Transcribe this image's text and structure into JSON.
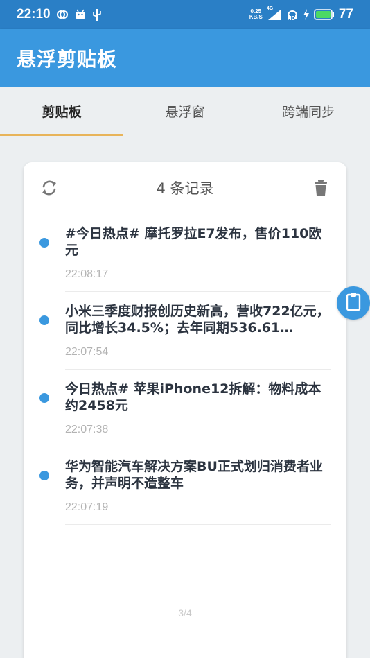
{
  "status_bar": {
    "time": "22:10",
    "net_speed_value": "0.25",
    "net_speed_unit": "KB/S",
    "network_type": "4G",
    "hd_label": "HD",
    "battery": "77",
    "icons": [
      "link-icon",
      "android-icon",
      "usb-icon",
      "signal-icon",
      "headset-hd-icon",
      "charging-icon",
      "battery-icon"
    ]
  },
  "app_bar": {
    "title": "悬浮剪贴板"
  },
  "tabs": [
    {
      "label": "剪贴板",
      "active": true
    },
    {
      "label": "悬浮窗",
      "active": false
    },
    {
      "label": "跨端同步",
      "active": false
    }
  ],
  "card": {
    "title": "4 条记录",
    "refresh_icon": "refresh-icon",
    "delete_icon": "trash-icon",
    "records": [
      {
        "text": "#今日热点# 摩托罗拉E7发布，售价110欧元",
        "time": "22:08:17"
      },
      {
        "text": "小米三季度财报创历史新高，营收722亿元，同比增长34.5%；去年同期536.61…",
        "time": "22:07:54"
      },
      {
        "text": "今日热点# 苹果iPhone12拆解：物料成本约2458元",
        "time": "22:07:38"
      },
      {
        "text": "华为智能汽车解决方案BU正式划归消费者业务，并声明不造整车",
        "time": "22:07:19"
      }
    ],
    "pager": "3/4"
  },
  "floating_button": {
    "icon": "clipboard-icon"
  },
  "colors": {
    "status_bar": "#2a7fc6",
    "app_bar": "#3a98df",
    "tab_indicator": "#e8b45a",
    "dot": "#3a98df",
    "background": "#eceff1"
  }
}
